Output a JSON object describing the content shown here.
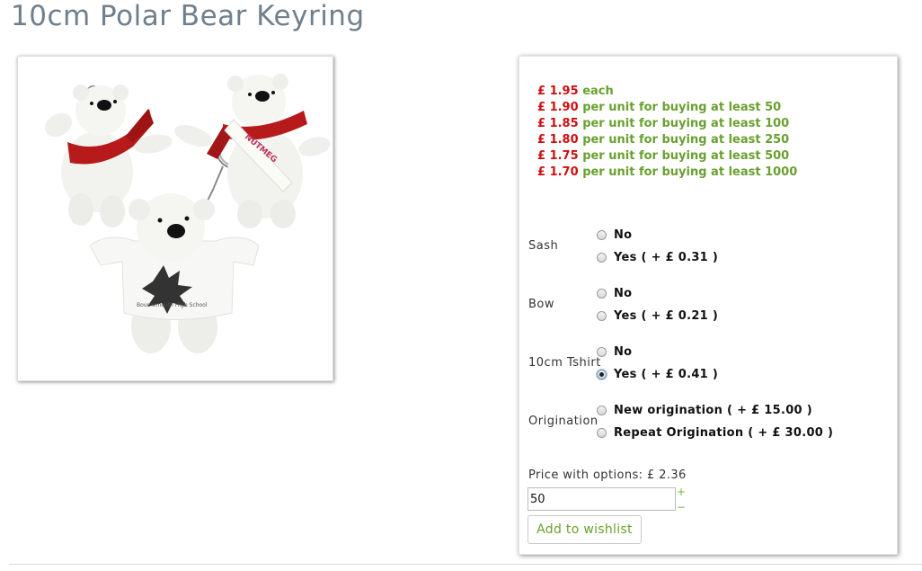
{
  "product": {
    "title": "10cm Polar Bear Keyring"
  },
  "pricing": {
    "tiers": [
      {
        "amount": "£ 1.95",
        "desc": "each"
      },
      {
        "amount": "£ 1.90",
        "desc": "per unit for buying at least 50"
      },
      {
        "amount": "£ 1.85",
        "desc": "per unit for buying at least 100"
      },
      {
        "amount": "£ 1.80",
        "desc": "per unit for buying at least 250"
      },
      {
        "amount": "£ 1.75",
        "desc": "per unit for buying at least 500"
      },
      {
        "amount": "£ 1.70",
        "desc": "per unit for buying at least 1000"
      }
    ]
  },
  "options": {
    "sash": {
      "label": "Sash",
      "choices": [
        {
          "label": "No",
          "checked": false
        },
        {
          "label": "Yes ( + £ 0.31 )",
          "checked": false
        }
      ]
    },
    "bow": {
      "label": "Bow",
      "choices": [
        {
          "label": "No",
          "checked": false
        },
        {
          "label": "Yes ( + £ 0.21 )",
          "checked": false
        }
      ]
    },
    "tshirt": {
      "label": "10cm Tshirt",
      "choices": [
        {
          "label": "No",
          "checked": false
        },
        {
          "label": "Yes ( + £ 0.41 )",
          "checked": true
        }
      ]
    },
    "origination": {
      "label": "Origination",
      "choices": [
        {
          "label": "New origination ( + £ 15.00 )",
          "checked": false
        },
        {
          "label": "Repeat Origination ( + £ 30.00 )",
          "checked": false
        }
      ]
    }
  },
  "summary": {
    "price_with_options": "Price with options: £ 2.36",
    "quantity": "50",
    "plus": "+",
    "minus": "−",
    "wishlist_label": "Add to wishlist"
  },
  "colors": {
    "title": "#6f7f8c",
    "price_red": "#cc1010",
    "price_green": "#6aa030"
  },
  "image": {
    "alt": "polar-bear-keyrings-photo"
  }
}
